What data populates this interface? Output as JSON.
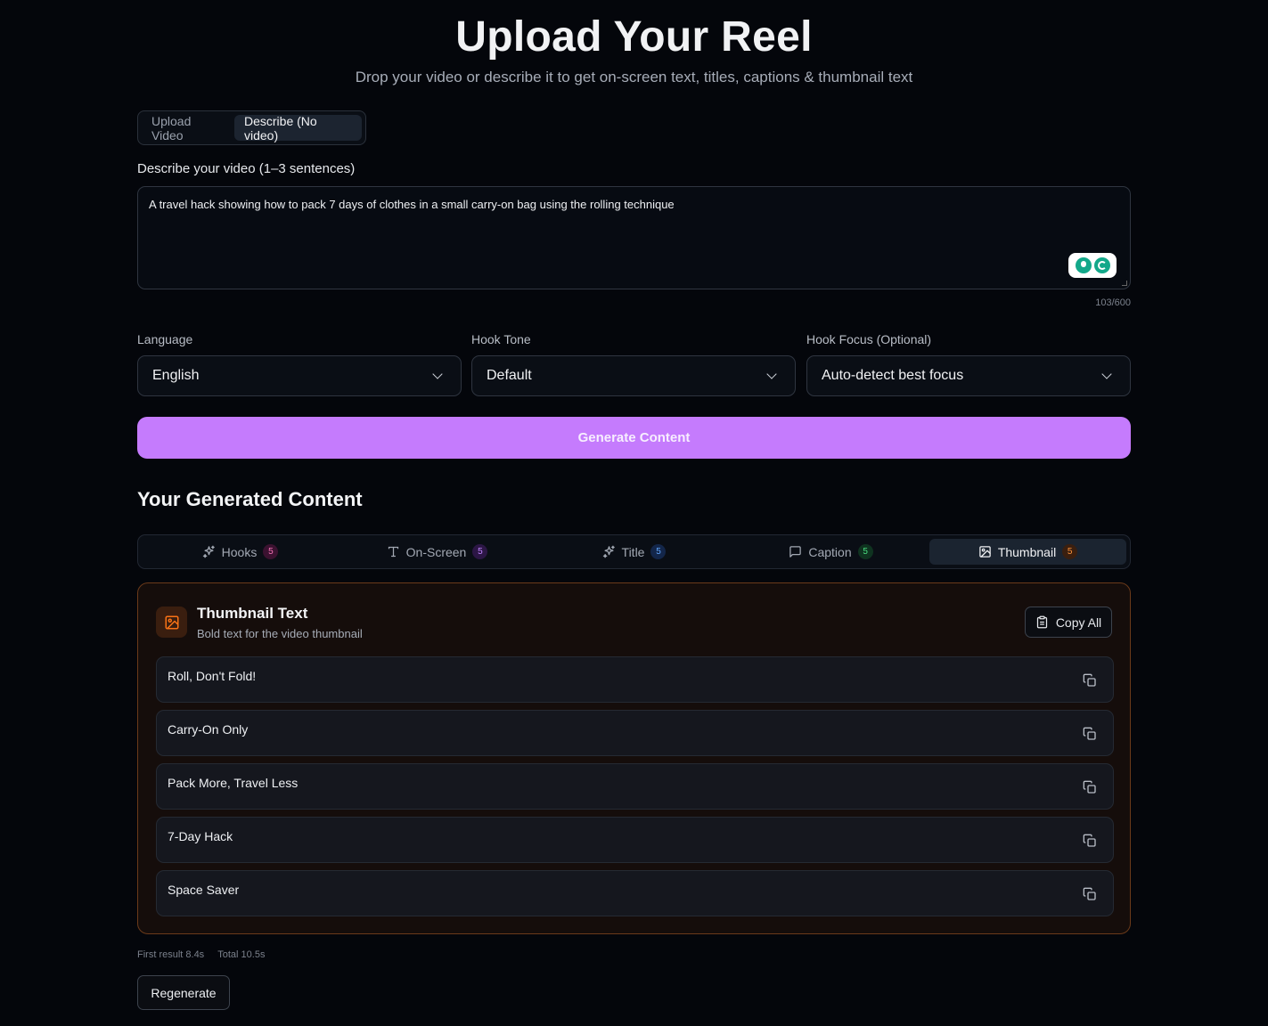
{
  "header": {
    "title": "Upload Your Reel",
    "subtitle": "Drop your video or describe it to get on-screen text, titles, captions & thumbnail text"
  },
  "mode_toggle": {
    "upload_label": "Upload Video",
    "describe_label": "Describe (No video)",
    "active": "describe"
  },
  "description": {
    "label": "Describe your video (1–3 sentences)",
    "value": "A travel hack showing how to pack 7 days of clothes in a small carry-on bag using the rolling technique",
    "char_count": "103/600"
  },
  "fields": {
    "language": {
      "label": "Language",
      "value": "English"
    },
    "hook_tone": {
      "label": "Hook Tone",
      "value": "Default"
    },
    "hook_focus": {
      "label": "Hook Focus (Optional)",
      "value": "Auto-detect best focus"
    }
  },
  "generate_label": "Generate Content",
  "results": {
    "section_title": "Your Generated Content",
    "tabs": [
      {
        "label": "Hooks",
        "count": "5",
        "icon": "sparkles-icon",
        "badge_color": "#f472b6",
        "badge_bg": "#3b1230"
      },
      {
        "label": "On-Screen",
        "count": "5",
        "icon": "type-icon",
        "badge_color": "#c084fc",
        "badge_bg": "#2c1645"
      },
      {
        "label": "Title",
        "count": "5",
        "icon": "sparkles-icon",
        "badge_color": "#60a5fa",
        "badge_bg": "#13264a"
      },
      {
        "label": "Caption",
        "count": "5",
        "icon": "message-square-icon",
        "badge_color": "#4ade80",
        "badge_bg": "#0f3320"
      },
      {
        "label": "Thumbnail",
        "count": "5",
        "icon": "image-icon",
        "badge_color": "#fb923c",
        "badge_bg": "#3a1f0f"
      }
    ],
    "active_tab": "Thumbnail",
    "card": {
      "title": "Thumbnail Text",
      "subtitle": "Bold text for the video thumbnail",
      "copy_all_label": "Copy All",
      "accent": "#f97316",
      "items": [
        "Roll, Don't Fold!",
        "Carry-On Only",
        "Pack More, Travel Less",
        "7-Day Hack",
        "Space Saver"
      ]
    },
    "timing": {
      "first": "First result 8.4s",
      "total": "Total 10.5s"
    },
    "regenerate_label": "Regenerate"
  }
}
